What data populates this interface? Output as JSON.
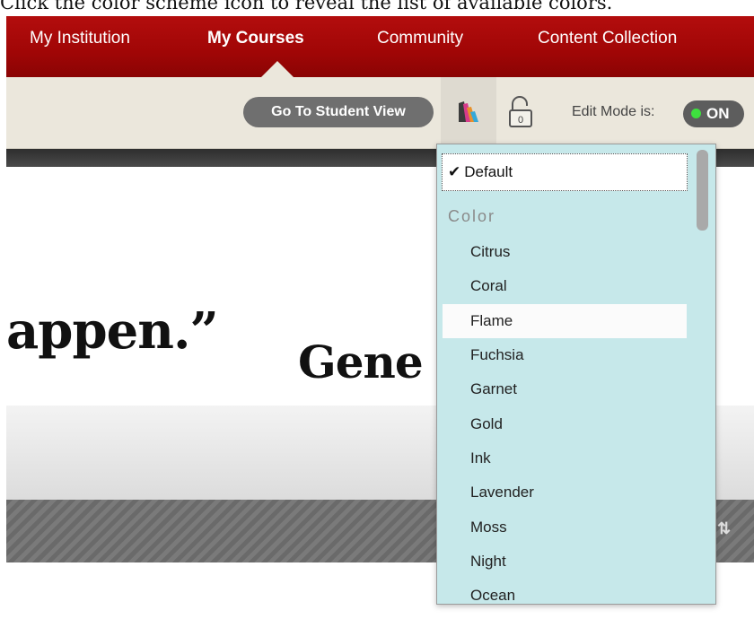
{
  "caption": "Click the color scheme icon to reveal the list of available colors.",
  "navbar": {
    "tabs": [
      {
        "label": "My Institution",
        "active": false
      },
      {
        "label": "My Courses",
        "active": true
      },
      {
        "label": "Community",
        "active": false
      },
      {
        "label": "Content Collection",
        "active": false
      }
    ]
  },
  "toolbar": {
    "student_view_label": "Go To Student View",
    "color_scheme_icon": "color-palette-icon",
    "lock_icon": "unlock-icon",
    "lock_count": "0",
    "edit_mode_label": "Edit Mode is:",
    "edit_mode_state": "ON"
  },
  "content": {
    "quote_fragment": "appen.”",
    "author_fragment": "Gene"
  },
  "color_menu": {
    "selected": "Default",
    "heading": "Color",
    "hovered": "Flame",
    "items": [
      "Citrus",
      "Coral",
      "Flame",
      "Fuchsia",
      "Garnet",
      "Gold",
      "Ink",
      "Lavender",
      "Moss",
      "Night",
      "Ocean"
    ]
  },
  "colors": {
    "nav_red": "#a00606",
    "toolbar_bg": "#ebe7dc",
    "menu_bg": "#c6e8ea",
    "toggle_on": "#3ee03e"
  }
}
